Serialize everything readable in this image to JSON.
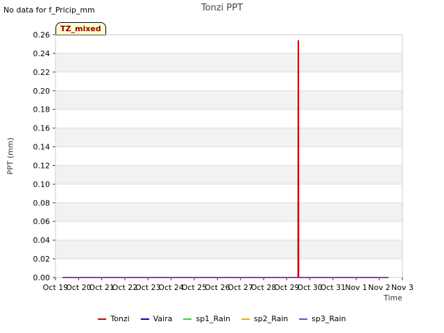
{
  "header": {
    "no_data_text": "No data for f_Pricip_mm",
    "badge": "TZ_mixed"
  },
  "chart_data": {
    "type": "line",
    "title": "Tonzi PPT",
    "xlabel": "Time",
    "ylabel": "PPT (mm)",
    "ylim": [
      0,
      0.26
    ],
    "yticks": [
      0.0,
      0.02,
      0.04,
      0.06,
      0.08,
      0.1,
      0.12,
      0.14,
      0.16,
      0.18,
      0.2,
      0.22,
      0.24,
      0.26
    ],
    "xlim": [
      0,
      15
    ],
    "xticks": [
      "Oct 19",
      "Oct 20",
      "Oct 21",
      "Oct 22",
      "Oct 23",
      "Oct 24",
      "Oct 25",
      "Oct 26",
      "Oct 27",
      "Oct 28",
      "Oct 29",
      "Oct 30",
      "Oct 31",
      "Nov 1",
      "Nov 2",
      "Nov 3"
    ],
    "grid": true,
    "legend_position": "bottom",
    "series": [
      {
        "name": "Tonzi",
        "color": "#cc0000",
        "points": [
          [
            0.3,
            0
          ],
          [
            10.49,
            0
          ],
          [
            10.5,
            0.254
          ],
          [
            10.51,
            0
          ],
          [
            14.4,
            0
          ]
        ]
      },
      {
        "name": "Vaira",
        "color": "#0000cc",
        "points": []
      },
      {
        "name": "sp1_Rain",
        "color": "#22dd22",
        "points": []
      },
      {
        "name": "sp2_Rain",
        "color": "#ffa500",
        "points": []
      },
      {
        "name": "sp3_Rain",
        "color": "#9933cc",
        "points": [
          [
            0.3,
            0
          ],
          [
            14.4,
            0
          ]
        ]
      }
    ]
  }
}
